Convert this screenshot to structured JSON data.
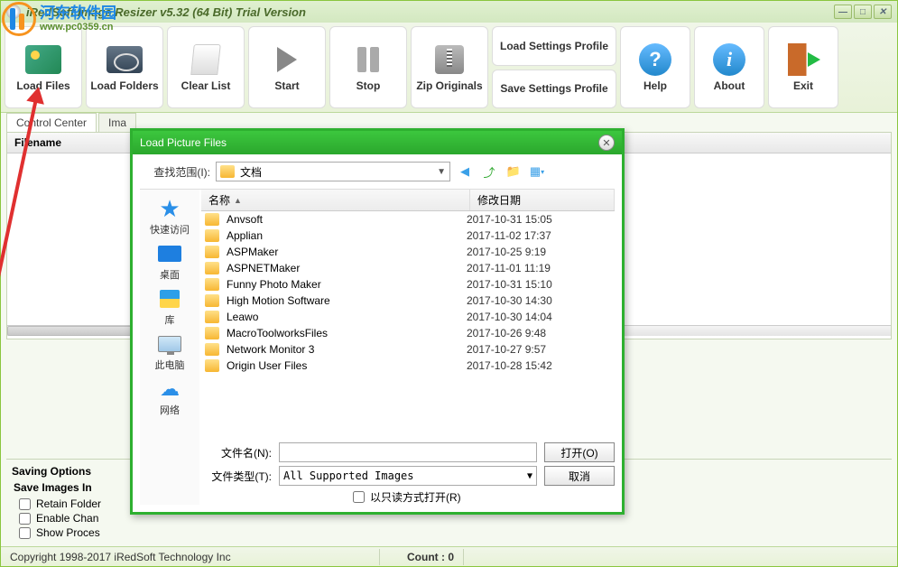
{
  "window": {
    "title": "iRedSoft Image Resizer v5.32 (64 Bit) Trial Version"
  },
  "toolbar": {
    "load_files": "Load Files",
    "load_folders": "Load Folders",
    "clear_list": "Clear List",
    "start": "Start",
    "stop": "Stop",
    "zip_originals": "Zip Originals",
    "load_settings": "Load Settings Profile",
    "save_settings": "Save Settings Profile",
    "help": "Help",
    "about": "About",
    "exit": "Exit"
  },
  "tabs": {
    "control": "Control Center",
    "image": "Ima"
  },
  "file_header": "Filename",
  "saving": {
    "title": "Saving Options",
    "save_in": "Save Images In",
    "retain": "Retain Folder",
    "enable": "Enable Chan",
    "show": "Show Proces"
  },
  "status": {
    "copyright": "Copyright 1998-2017 iRedSoft Technology Inc",
    "count": "Count : 0"
  },
  "dialog": {
    "title": "Load Picture Files",
    "look_in_label": "查找范围(I):",
    "look_in_value": "文档",
    "col_name": "名称",
    "col_date": "修改日期",
    "filename_label": "文件名(N):",
    "filename_value": "",
    "filetype_label": "文件类型(T):",
    "filetype_value": "All Supported Images",
    "open_btn": "打开(O)",
    "cancel_btn": "取消",
    "readonly": "以只读方式打开(R)",
    "sidebar": {
      "quick": "快速访问",
      "desktop": "桌面",
      "lib": "库",
      "pc": "此电脑",
      "net": "网络"
    },
    "files": [
      {
        "name": "Anvsoft",
        "date": "2017-10-31 15:05"
      },
      {
        "name": "Applian",
        "date": "2017-11-02 17:37"
      },
      {
        "name": "ASPMaker",
        "date": "2017-10-25 9:19"
      },
      {
        "name": "ASPNETMaker",
        "date": "2017-11-01 11:19"
      },
      {
        "name": "Funny Photo Maker",
        "date": "2017-10-31 15:10"
      },
      {
        "name": "High Motion Software",
        "date": "2017-10-30 14:30"
      },
      {
        "name": "Leawo",
        "date": "2017-10-30 14:04"
      },
      {
        "name": "MacroToolworksFiles",
        "date": "2017-10-26 9:48"
      },
      {
        "name": "Network Monitor 3",
        "date": "2017-10-27 9:57"
      },
      {
        "name": "Origin User Files",
        "date": "2017-10-28 15:42"
      }
    ]
  },
  "watermark": {
    "cn": "河东软件园",
    "url": "www.pc0359.cn",
    "faint": "www.pc0359.cn"
  }
}
